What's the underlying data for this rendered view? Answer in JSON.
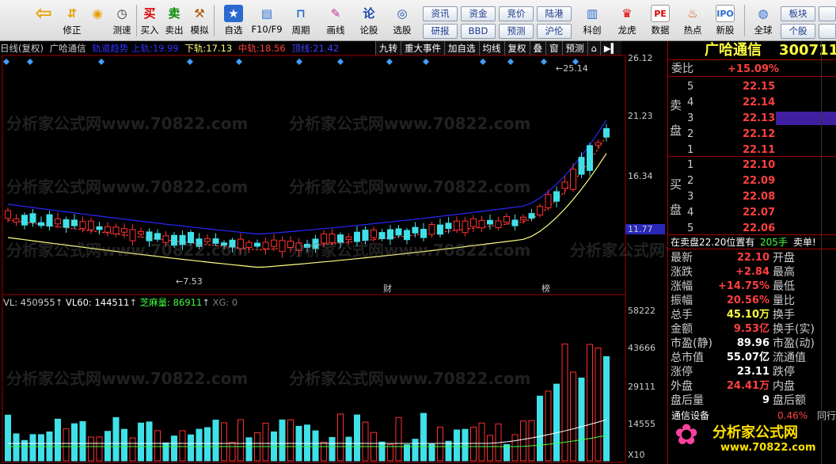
{
  "toolbar": {
    "buttons": [
      {
        "label": "修正",
        "icon": "up-down-arrow-icon"
      },
      {
        "label": "测速",
        "icon": "speed-icon"
      },
      {
        "label": "买入",
        "icon": "buy-icon",
        "glyph": "买"
      },
      {
        "label": "卖出",
        "icon": "sell-icon",
        "glyph": "卖"
      },
      {
        "label": "模拟",
        "icon": "hammer-icon"
      },
      {
        "label": "自选",
        "icon": "star-icon"
      },
      {
        "label": "F10/F9",
        "icon": "f10-icon"
      },
      {
        "label": "周期",
        "icon": "period-icon"
      },
      {
        "label": "画线",
        "icon": "pen-icon"
      },
      {
        "label": "论股",
        "icon": "forum-icon",
        "glyph": "论"
      },
      {
        "label": "选股",
        "icon": "select-stock-icon"
      },
      {
        "label": "科创",
        "icon": "kechuang-icon"
      },
      {
        "label": "龙虎",
        "icon": "dragon-tiger-icon"
      },
      {
        "label": "数据",
        "icon": "data-icon",
        "glyph": "PE"
      },
      {
        "label": "热点",
        "icon": "hotspot-icon"
      },
      {
        "label": "新股",
        "icon": "ipo-icon"
      },
      {
        "label": "全球",
        "icon": "globe-icon"
      }
    ],
    "small_buttons": [
      "资讯",
      "研报",
      "资金",
      "BBD",
      "竞价",
      "预测",
      "陆港",
      "沪伦",
      "板块",
      "个股"
    ]
  },
  "chart": {
    "infobar": {
      "period": "日线(复权)",
      "name": "广哈通信",
      "upper_label": "轨道趋势 上轨:",
      "upper_value": "19.99",
      "lower_label": "下轨:",
      "lower_value": "17.13",
      "mid_label": "中轨:",
      "mid_value": "18.56",
      "top_label": "顶线:",
      "top_value": "21.42"
    },
    "menu": [
      "九转",
      "重大事件",
      "加自选",
      "均线",
      "复权",
      "叠",
      "窗",
      "预测"
    ],
    "price_ticks": [
      "26.12",
      "21.23",
      "16.34",
      "11.77"
    ],
    "annotations": {
      "high": "25.14",
      "low": "7.53",
      "cai": "财",
      "bang": "榜"
    },
    "volume_info": {
      "vl": "VL: 450955",
      "vl60": "VL60: 144511",
      "zmf": "芝麻量: 86911",
      "xg": "XG: 0"
    },
    "volume_ticks": [
      "58222",
      "43666",
      "29111",
      "14555",
      "X10"
    ],
    "colors": {
      "up": "#ff3030",
      "down": "#40e0e8",
      "band_upper": "#2828ff",
      "band_mid": "#ff4040",
      "band_lower": "#ffff80"
    }
  },
  "right_panel": {
    "header_name": "广哈通信",
    "header_code": "300711",
    "weibi_label": "委比",
    "weibi_value": "+15.09%",
    "sell_label": "卖盘",
    "buy_label": "买盘",
    "asks": [
      {
        "n": "5",
        "price": "22.15"
      },
      {
        "n": "4",
        "price": "22.14"
      },
      {
        "n": "3",
        "price": "22.13"
      },
      {
        "n": "2",
        "price": "22.12"
      },
      {
        "n": "1",
        "price": "22.11"
      }
    ],
    "bids": [
      {
        "n": "1",
        "price": "22.10"
      },
      {
        "n": "2",
        "price": "22.09"
      },
      {
        "n": "3",
        "price": "22.08"
      },
      {
        "n": "4",
        "price": "22.07"
      },
      {
        "n": "5",
        "price": "22.06"
      }
    ],
    "position_text": "在卖盘22.20位置有",
    "position_hands": "205手",
    "position_note": "卖单!",
    "stats": [
      {
        "l": "最新",
        "v": "22.10",
        "r": "开盘"
      },
      {
        "l": "涨跌",
        "v": "+2.84",
        "r": "最高"
      },
      {
        "l": "涨幅",
        "v": "+14.75%",
        "r": "最低"
      },
      {
        "l": "振幅",
        "v": "20.56%",
        "r": "量比"
      },
      {
        "l": "总手",
        "v": "45.10万",
        "r": "换手"
      },
      {
        "l": "金额",
        "v": "9.53亿",
        "r": "换手(实)"
      },
      {
        "l": "市盈(静)",
        "v": "89.96",
        "r": "市盈(动)"
      },
      {
        "l": "总市值",
        "v": "55.07亿",
        "r": "流通值"
      },
      {
        "l": "涨停",
        "v": "23.11",
        "r": "跌停"
      },
      {
        "l": "外盘",
        "v": "24.41万",
        "r": "内盘"
      },
      {
        "l": "盘后量",
        "v": "9",
        "r": "盘后额"
      }
    ],
    "bottom_label": "通信设备",
    "bottom_value": "0.46%",
    "bottom_right": "同行"
  },
  "watermark": "分析家公式网www.70822.com",
  "brand": {
    "name": "分析家公式网",
    "url": "www.70822.com"
  }
}
